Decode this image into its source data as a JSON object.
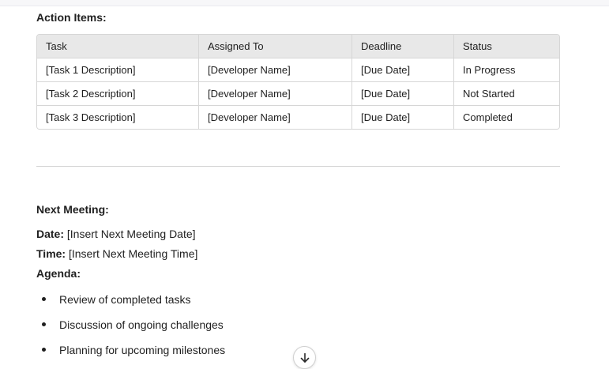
{
  "action_items": {
    "heading": "Action Items:",
    "columns": [
      "Task",
      "Assigned To",
      "Deadline",
      "Status"
    ],
    "rows": [
      [
        "[Task 1 Description]",
        "[Developer Name]",
        "[Due Date]",
        "In Progress"
      ],
      [
        "[Task 2 Description]",
        "[Developer Name]",
        "[Due Date]",
        "Not Started"
      ],
      [
        "[Task 3 Description]",
        "[Developer Name]",
        "[Due Date]",
        "Completed"
      ]
    ]
  },
  "next_meeting": {
    "heading": "Next Meeting:",
    "date_label": "Date:",
    "date_value": " [Insert Next Meeting Date]",
    "time_label": "Time:",
    "time_value": " [Insert Next Meeting Time]",
    "agenda_label": "Agenda:",
    "agenda_items": [
      "Review of completed tasks",
      "Discussion of ongoing challenges",
      "Planning for upcoming milestones"
    ]
  },
  "icons": {
    "scroll_down": "arrow-down-icon"
  }
}
